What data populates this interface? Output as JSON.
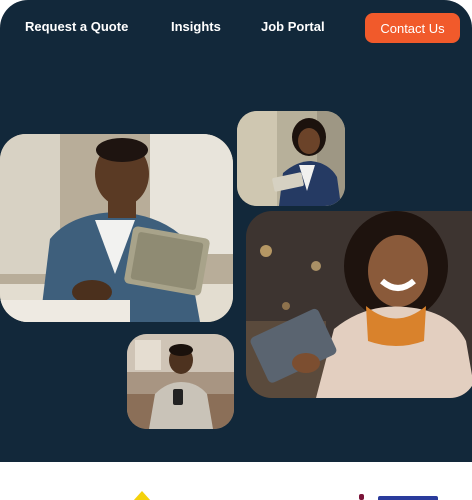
{
  "nav": {
    "links": [
      {
        "label": "Request a Quote"
      },
      {
        "label": "Insights"
      },
      {
        "label": "Job Portal"
      }
    ],
    "cta_label": "Contact Us"
  },
  "colors": {
    "hero_background": "#12283a",
    "cta_background": "#f15a2b",
    "partner_logo_yellow": "#f4d10b",
    "partner_logo_maroon": "#7a1438",
    "partner_logo_blue": "#2a3b9c"
  },
  "photos": [
    {
      "subject": "smiling man with tablet at desk"
    },
    {
      "subject": "businesswoman holding tablet"
    },
    {
      "subject": "smiling woman holding tablet"
    },
    {
      "subject": "man seated using phone"
    }
  ],
  "partner_logos": [
    "yellow-triangle-logo",
    "maroon-blue-logo"
  ]
}
